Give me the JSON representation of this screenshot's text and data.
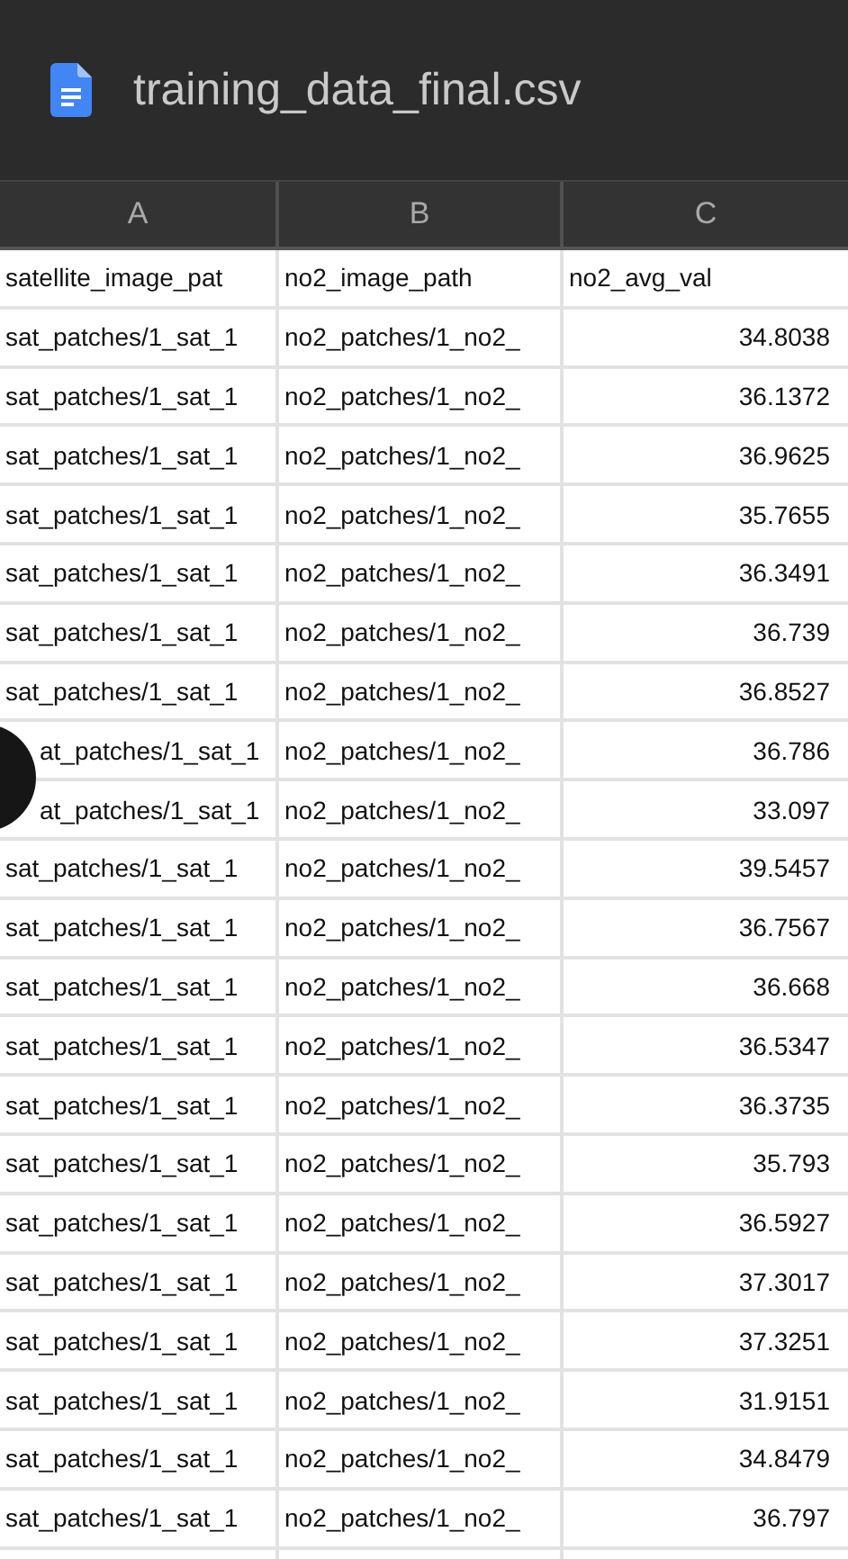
{
  "window": {
    "title": "training_data_final.csv"
  },
  "table": {
    "columns": [
      "A",
      "B",
      "C"
    ],
    "rows": [
      {
        "cells": [
          "satellite_image_pat",
          "no2_image_path",
          "no2_avg_val"
        ],
        "kind": "text",
        "covered": false
      },
      {
        "cells": [
          "sat_patches/1_sat_1",
          "no2_patches/1_no2_",
          "34.8038"
        ],
        "kind": "number",
        "covered": false
      },
      {
        "cells": [
          "sat_patches/1_sat_1",
          "no2_patches/1_no2_",
          "36.1372"
        ],
        "kind": "number",
        "covered": false
      },
      {
        "cells": [
          "sat_patches/1_sat_1",
          "no2_patches/1_no2_",
          "36.9625"
        ],
        "kind": "number",
        "covered": false
      },
      {
        "cells": [
          "sat_patches/1_sat_1",
          "no2_patches/1_no2_",
          "35.7655"
        ],
        "kind": "number",
        "covered": false
      },
      {
        "cells": [
          "sat_patches/1_sat_1",
          "no2_patches/1_no2_",
          "36.3491"
        ],
        "kind": "number",
        "covered": false
      },
      {
        "cells": [
          "sat_patches/1_sat_1",
          "no2_patches/1_no2_",
          "36.739"
        ],
        "kind": "number",
        "covered": false
      },
      {
        "cells": [
          "sat_patches/1_sat_1",
          "no2_patches/1_no2_",
          "36.8527"
        ],
        "kind": "number",
        "covered": false
      },
      {
        "cells": [
          "at_patches/1_sat_1",
          "no2_patches/1_no2_",
          "36.786"
        ],
        "kind": "number",
        "covered": true
      },
      {
        "cells": [
          "at_patches/1_sat_1",
          "no2_patches/1_no2_",
          "33.097"
        ],
        "kind": "number",
        "covered": true
      },
      {
        "cells": [
          "sat_patches/1_sat_1",
          "no2_patches/1_no2_",
          "39.5457"
        ],
        "kind": "number",
        "covered": false
      },
      {
        "cells": [
          "sat_patches/1_sat_1",
          "no2_patches/1_no2_",
          "36.7567"
        ],
        "kind": "number",
        "covered": false
      },
      {
        "cells": [
          "sat_patches/1_sat_1",
          "no2_patches/1_no2_",
          "36.668"
        ],
        "kind": "number",
        "covered": false
      },
      {
        "cells": [
          "sat_patches/1_sat_1",
          "no2_patches/1_no2_",
          "36.5347"
        ],
        "kind": "number",
        "covered": false
      },
      {
        "cells": [
          "sat_patches/1_sat_1",
          "no2_patches/1_no2_",
          "36.3735"
        ],
        "kind": "number",
        "covered": false
      },
      {
        "cells": [
          "sat_patches/1_sat_1",
          "no2_patches/1_no2_",
          "35.793"
        ],
        "kind": "number",
        "covered": false
      },
      {
        "cells": [
          "sat_patches/1_sat_1",
          "no2_patches/1_no2_",
          "36.5927"
        ],
        "kind": "number",
        "covered": false
      },
      {
        "cells": [
          "sat_patches/1_sat_1",
          "no2_patches/1_no2_",
          "37.3017"
        ],
        "kind": "number",
        "covered": false
      },
      {
        "cells": [
          "sat_patches/1_sat_1",
          "no2_patches/1_no2_",
          "37.3251"
        ],
        "kind": "number",
        "covered": false
      },
      {
        "cells": [
          "sat_patches/1_sat_1",
          "no2_patches/1_no2_",
          "31.9151"
        ],
        "kind": "number",
        "covered": false
      },
      {
        "cells": [
          "sat_patches/1_sat_1",
          "no2_patches/1_no2_",
          "34.8479"
        ],
        "kind": "number",
        "covered": false
      },
      {
        "cells": [
          "sat_patches/1_sat_1",
          "no2_patches/1_no2_",
          "36.797"
        ],
        "kind": "number",
        "covered": false
      }
    ]
  }
}
